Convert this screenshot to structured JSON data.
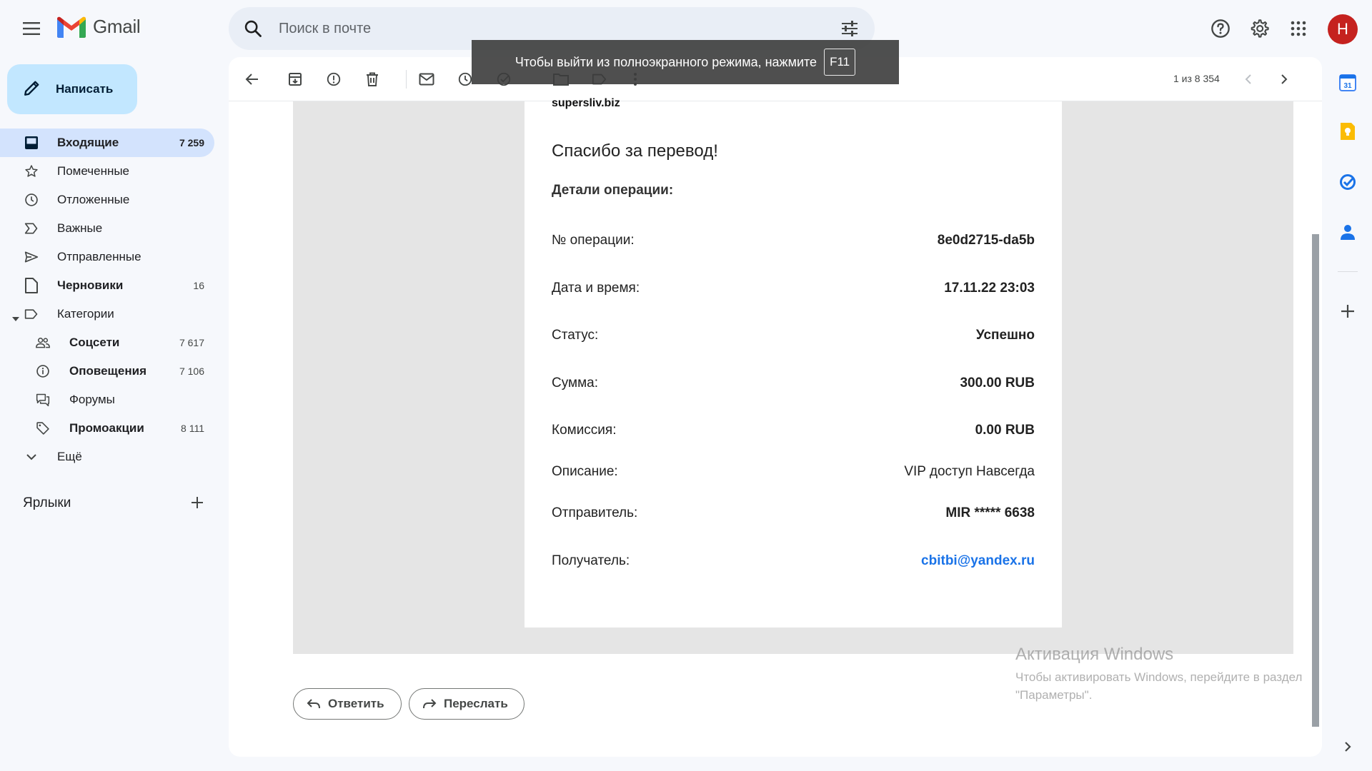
{
  "app": {
    "name": "Gmail"
  },
  "search": {
    "placeholder": "Поиск в почте"
  },
  "account": {
    "initial": "Н",
    "color": "#c5221f"
  },
  "compose": {
    "label": "Написать"
  },
  "nav": {
    "inbox": {
      "label": "Входящие",
      "count": "7 259"
    },
    "starred": {
      "label": "Помеченные"
    },
    "snoozed": {
      "label": "Отложенные"
    },
    "important": {
      "label": "Важные"
    },
    "sent": {
      "label": "Отправленные"
    },
    "drafts": {
      "label": "Черновики",
      "count": "16"
    },
    "categories": {
      "label": "Категории"
    },
    "social": {
      "label": "Соцсети",
      "count": "7 617"
    },
    "updates": {
      "label": "Оповещения",
      "count": "7 106"
    },
    "forums": {
      "label": "Форумы"
    },
    "promos": {
      "label": "Промоакции",
      "count": "8 111"
    },
    "more": {
      "label": "Ещё"
    }
  },
  "labels": {
    "header": "Ярлыки"
  },
  "toolbar": {
    "pager": "1 из 8 354"
  },
  "toast": {
    "text": "Чтобы выйти из полноэкранного режима, нажмите",
    "key": "F11"
  },
  "email": {
    "sender_clip": "supersliv.biz",
    "heading": "Спасибо за перевод!",
    "details_title": "Детали операции:",
    "rows": [
      {
        "key": "№ операции:",
        "value": "8e0d2715-da5b"
      },
      {
        "key": "Дата и время:",
        "value": "17.11.22 23:03"
      },
      {
        "key": "Статус:",
        "value": "Успешно"
      },
      {
        "key": "Сумма:",
        "value": "300.00 RUB"
      },
      {
        "key": "Комиссия:",
        "value": "0.00 RUB"
      },
      {
        "key": "Описание:",
        "value": "VIP доступ Навсегда"
      },
      {
        "key": "Отправитель:",
        "value": "MIR ***** 6638"
      },
      {
        "key": "Получатель:",
        "value": "cbitbi@yandex.ru"
      }
    ]
  },
  "actions": {
    "reply": "Ответить",
    "forward": "Переслать"
  },
  "watermark": {
    "title": "Активация Windows",
    "body": "Чтобы активировать Windows, перейдите в раздел \"Параметры\"."
  }
}
